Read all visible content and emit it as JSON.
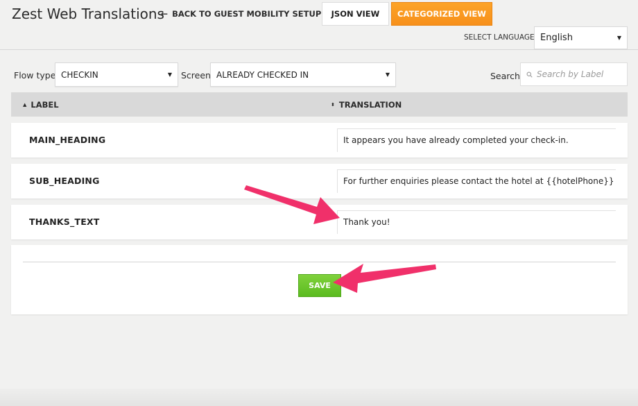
{
  "header": {
    "title": "Zest Web Translations",
    "back_link": "BACK TO GUEST MOBILITY SETUP",
    "json_view": "JSON VIEW",
    "categorized_view": "CATEGORIZED VIEW",
    "select_language_label": "SELECT LANGUAGE",
    "language_value": "English"
  },
  "filters": {
    "flow_type_label": "Flow type",
    "flow_type_value": "CHECKIN",
    "screen_label": "Screen",
    "screen_value": "ALREADY CHECKED IN",
    "search_label": "Search",
    "search_placeholder": "Search by Label",
    "search_value": ""
  },
  "table": {
    "columns": [
      "LABEL",
      "TRANSLATION"
    ],
    "rows": [
      {
        "label": "MAIN_HEADING",
        "translation": "It appears you have already completed your check-in."
      },
      {
        "label": "SUB_HEADING",
        "translation": "For further enquiries please contact the hotel at {{hotelPhone}}"
      },
      {
        "label": "THANKS_TEXT",
        "translation": "Thank you!"
      }
    ]
  },
  "footer": {
    "save_label": "SAVE"
  },
  "colors": {
    "accent_orange": "#f7901b",
    "save_green": "#5bbb20",
    "annotation_arrow": "#f0306a"
  },
  "icons": {
    "back": "arrow-left-icon",
    "caret": "caret-down-icon",
    "search": "search-icon",
    "sort_asc": "sort-asc-icon",
    "sort_both": "sort-both-icon"
  }
}
